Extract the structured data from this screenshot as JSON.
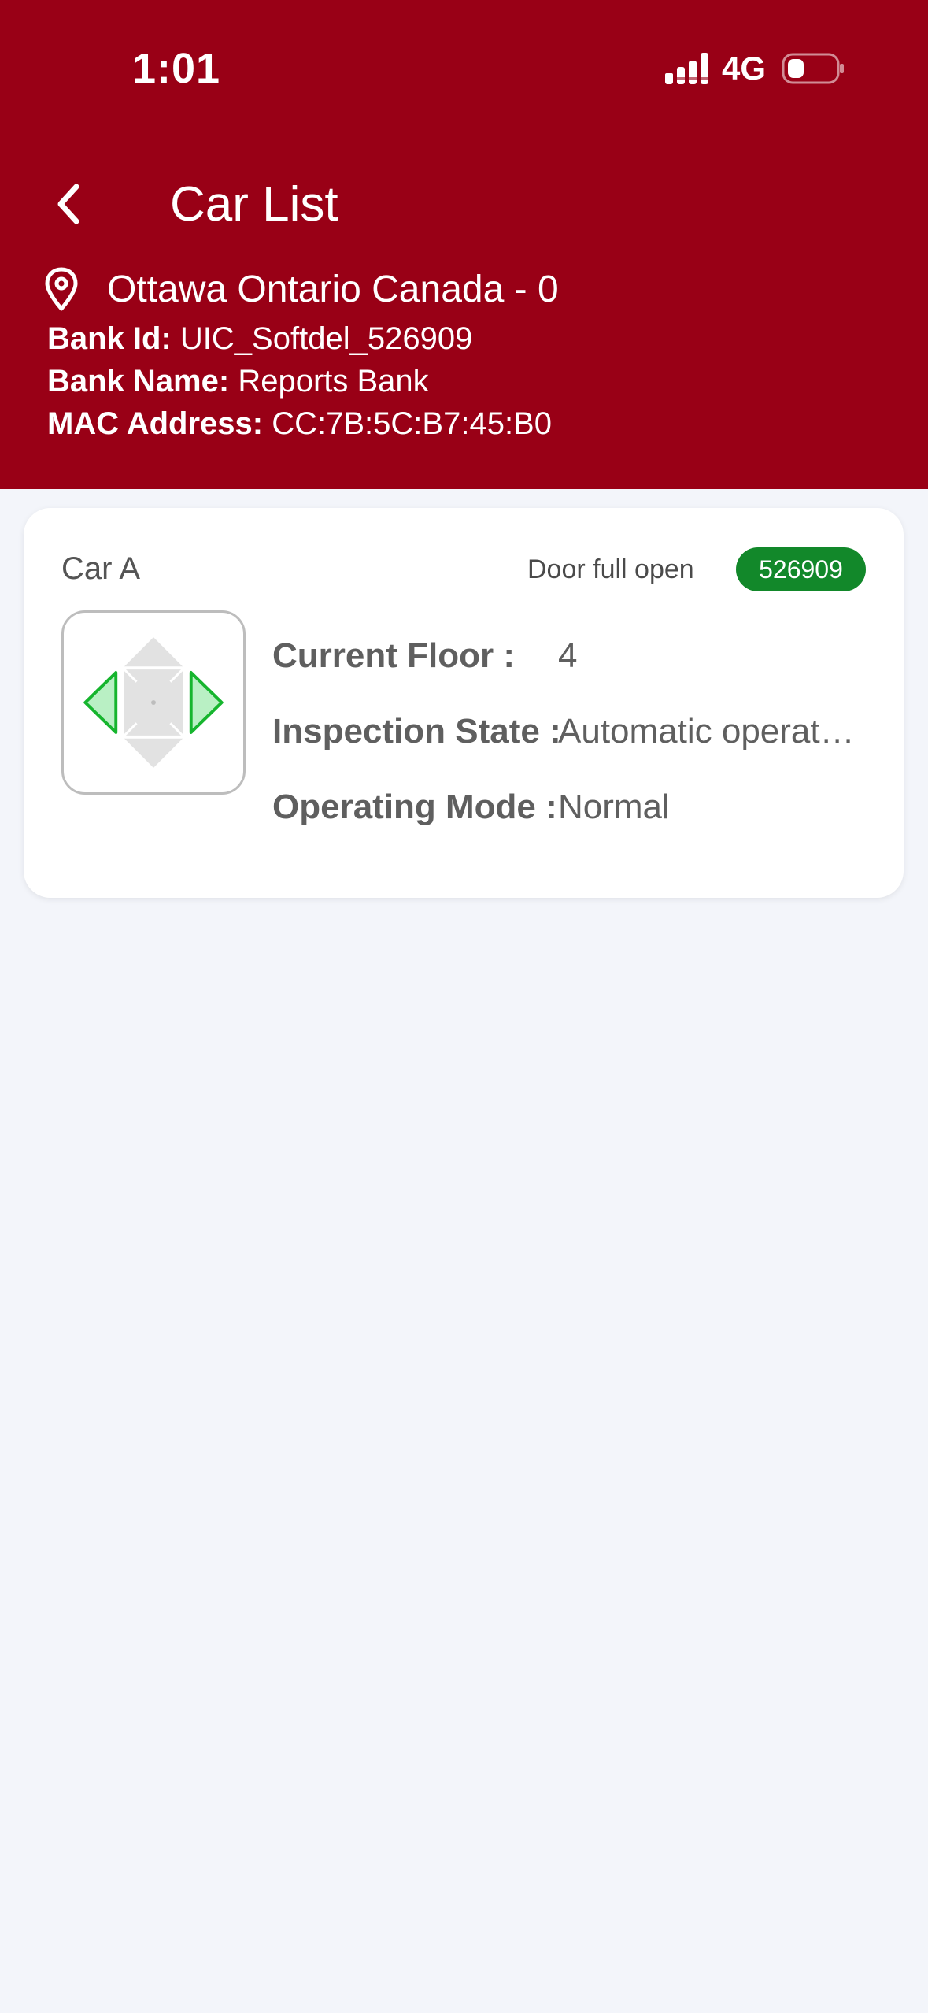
{
  "status_bar": {
    "time": "1:01",
    "network": "4G",
    "signal_icon": "cellular-signal-icon",
    "battery_icon": "battery-low-icon"
  },
  "header": {
    "title": "Car List",
    "back_icon": "chevron-left-icon",
    "location_icon": "map-pin-icon",
    "location": "Ottawa Ontario Canada - 0",
    "bank_id_label": "Bank Id:",
    "bank_id_value": "UIC_Softdel_526909",
    "bank_name_label": "Bank Name:",
    "bank_name_value": "Reports Bank",
    "mac_label": "MAC Address:",
    "mac_value": "CC:7B:5C:B7:45:B0",
    "background_color": "#990016"
  },
  "cars": [
    {
      "name": "Car A",
      "door_status": "Door full open",
      "badge": "526909",
      "badge_color": "#12882a",
      "icon": "elevator-car-doors-open-icon",
      "fields": [
        {
          "label": "Current Floor :",
          "value": "4"
        },
        {
          "label": "Inspection State :",
          "value": "Automatic operat…"
        },
        {
          "label": "Operating Mode :",
          "value": "Normal"
        }
      ]
    }
  ]
}
